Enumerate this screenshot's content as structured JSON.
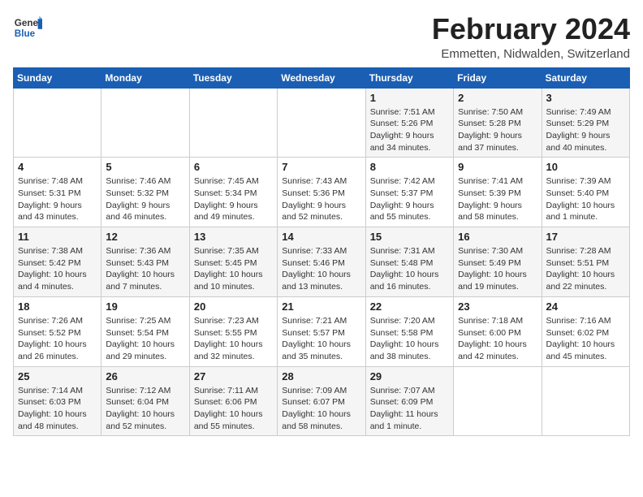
{
  "header": {
    "logo_general": "General",
    "logo_blue": "Blue",
    "month": "February 2024",
    "location": "Emmetten, Nidwalden, Switzerland"
  },
  "days_of_week": [
    "Sunday",
    "Monday",
    "Tuesday",
    "Wednesday",
    "Thursday",
    "Friday",
    "Saturday"
  ],
  "weeks": [
    [
      {
        "day": "",
        "text": ""
      },
      {
        "day": "",
        "text": ""
      },
      {
        "day": "",
        "text": ""
      },
      {
        "day": "",
        "text": ""
      },
      {
        "day": "1",
        "text": "Sunrise: 7:51 AM\nSunset: 5:26 PM\nDaylight: 9 hours\nand 34 minutes."
      },
      {
        "day": "2",
        "text": "Sunrise: 7:50 AM\nSunset: 5:28 PM\nDaylight: 9 hours\nand 37 minutes."
      },
      {
        "day": "3",
        "text": "Sunrise: 7:49 AM\nSunset: 5:29 PM\nDaylight: 9 hours\nand 40 minutes."
      }
    ],
    [
      {
        "day": "4",
        "text": "Sunrise: 7:48 AM\nSunset: 5:31 PM\nDaylight: 9 hours\nand 43 minutes."
      },
      {
        "day": "5",
        "text": "Sunrise: 7:46 AM\nSunset: 5:32 PM\nDaylight: 9 hours\nand 46 minutes."
      },
      {
        "day": "6",
        "text": "Sunrise: 7:45 AM\nSunset: 5:34 PM\nDaylight: 9 hours\nand 49 minutes."
      },
      {
        "day": "7",
        "text": "Sunrise: 7:43 AM\nSunset: 5:36 PM\nDaylight: 9 hours\nand 52 minutes."
      },
      {
        "day": "8",
        "text": "Sunrise: 7:42 AM\nSunset: 5:37 PM\nDaylight: 9 hours\nand 55 minutes."
      },
      {
        "day": "9",
        "text": "Sunrise: 7:41 AM\nSunset: 5:39 PM\nDaylight: 9 hours\nand 58 minutes."
      },
      {
        "day": "10",
        "text": "Sunrise: 7:39 AM\nSunset: 5:40 PM\nDaylight: 10 hours\nand 1 minute."
      }
    ],
    [
      {
        "day": "11",
        "text": "Sunrise: 7:38 AM\nSunset: 5:42 PM\nDaylight: 10 hours\nand 4 minutes."
      },
      {
        "day": "12",
        "text": "Sunrise: 7:36 AM\nSunset: 5:43 PM\nDaylight: 10 hours\nand 7 minutes."
      },
      {
        "day": "13",
        "text": "Sunrise: 7:35 AM\nSunset: 5:45 PM\nDaylight: 10 hours\nand 10 minutes."
      },
      {
        "day": "14",
        "text": "Sunrise: 7:33 AM\nSunset: 5:46 PM\nDaylight: 10 hours\nand 13 minutes."
      },
      {
        "day": "15",
        "text": "Sunrise: 7:31 AM\nSunset: 5:48 PM\nDaylight: 10 hours\nand 16 minutes."
      },
      {
        "day": "16",
        "text": "Sunrise: 7:30 AM\nSunset: 5:49 PM\nDaylight: 10 hours\nand 19 minutes."
      },
      {
        "day": "17",
        "text": "Sunrise: 7:28 AM\nSunset: 5:51 PM\nDaylight: 10 hours\nand 22 minutes."
      }
    ],
    [
      {
        "day": "18",
        "text": "Sunrise: 7:26 AM\nSunset: 5:52 PM\nDaylight: 10 hours\nand 26 minutes."
      },
      {
        "day": "19",
        "text": "Sunrise: 7:25 AM\nSunset: 5:54 PM\nDaylight: 10 hours\nand 29 minutes."
      },
      {
        "day": "20",
        "text": "Sunrise: 7:23 AM\nSunset: 5:55 PM\nDaylight: 10 hours\nand 32 minutes."
      },
      {
        "day": "21",
        "text": "Sunrise: 7:21 AM\nSunset: 5:57 PM\nDaylight: 10 hours\nand 35 minutes."
      },
      {
        "day": "22",
        "text": "Sunrise: 7:20 AM\nSunset: 5:58 PM\nDaylight: 10 hours\nand 38 minutes."
      },
      {
        "day": "23",
        "text": "Sunrise: 7:18 AM\nSunset: 6:00 PM\nDaylight: 10 hours\nand 42 minutes."
      },
      {
        "day": "24",
        "text": "Sunrise: 7:16 AM\nSunset: 6:02 PM\nDaylight: 10 hours\nand 45 minutes."
      }
    ],
    [
      {
        "day": "25",
        "text": "Sunrise: 7:14 AM\nSunset: 6:03 PM\nDaylight: 10 hours\nand 48 minutes."
      },
      {
        "day": "26",
        "text": "Sunrise: 7:12 AM\nSunset: 6:04 PM\nDaylight: 10 hours\nand 52 minutes."
      },
      {
        "day": "27",
        "text": "Sunrise: 7:11 AM\nSunset: 6:06 PM\nDaylight: 10 hours\nand 55 minutes."
      },
      {
        "day": "28",
        "text": "Sunrise: 7:09 AM\nSunset: 6:07 PM\nDaylight: 10 hours\nand 58 minutes."
      },
      {
        "day": "29",
        "text": "Sunrise: 7:07 AM\nSunset: 6:09 PM\nDaylight: 11 hours\nand 1 minute."
      },
      {
        "day": "",
        "text": ""
      },
      {
        "day": "",
        "text": ""
      }
    ]
  ]
}
